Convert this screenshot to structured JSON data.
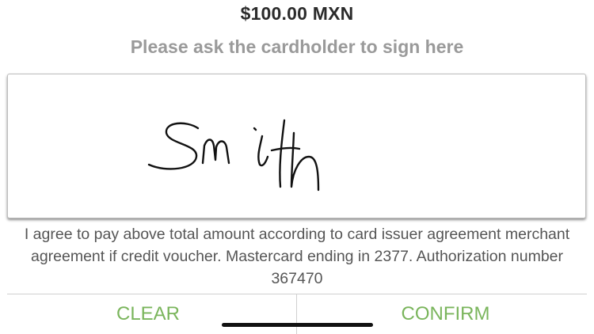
{
  "payment": {
    "amount": "$100.00 MXN",
    "instruction": "Please ask the cardholder to sign here"
  },
  "signature": {
    "text": "Smith",
    "ink_color": "#111111"
  },
  "agreement": {
    "text": "I agree to pay above total amount according to card issuer agreement merchant agreement if credit voucher. Mastercard ending in 2377. Authorization number 367470"
  },
  "actions": {
    "clear_label": "CLEAR",
    "confirm_label": "CONFIRM",
    "accent_color": "#7ab55c"
  }
}
